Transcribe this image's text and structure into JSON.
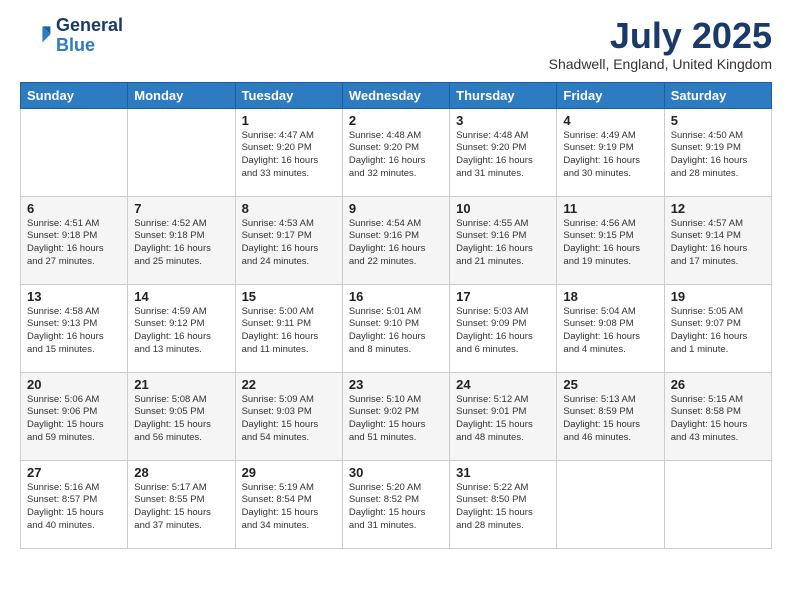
{
  "logo": {
    "general": "General",
    "blue": "Blue"
  },
  "title": "July 2025",
  "subtitle": "Shadwell, England, United Kingdom",
  "headers": [
    "Sunday",
    "Monday",
    "Tuesday",
    "Wednesday",
    "Thursday",
    "Friday",
    "Saturday"
  ],
  "weeks": [
    [
      null,
      null,
      {
        "num": "1",
        "sunrise": "4:47 AM",
        "sunset": "9:20 PM",
        "daylight": "16 hours and 33 minutes."
      },
      {
        "num": "2",
        "sunrise": "4:48 AM",
        "sunset": "9:20 PM",
        "daylight": "16 hours and 32 minutes."
      },
      {
        "num": "3",
        "sunrise": "4:48 AM",
        "sunset": "9:20 PM",
        "daylight": "16 hours and 31 minutes."
      },
      {
        "num": "4",
        "sunrise": "4:49 AM",
        "sunset": "9:19 PM",
        "daylight": "16 hours and 30 minutes."
      },
      {
        "num": "5",
        "sunrise": "4:50 AM",
        "sunset": "9:19 PM",
        "daylight": "16 hours and 28 minutes."
      }
    ],
    [
      {
        "num": "6",
        "sunrise": "4:51 AM",
        "sunset": "9:18 PM",
        "daylight": "16 hours and 27 minutes."
      },
      {
        "num": "7",
        "sunrise": "4:52 AM",
        "sunset": "9:18 PM",
        "daylight": "16 hours and 25 minutes."
      },
      {
        "num": "8",
        "sunrise": "4:53 AM",
        "sunset": "9:17 PM",
        "daylight": "16 hours and 24 minutes."
      },
      {
        "num": "9",
        "sunrise": "4:54 AM",
        "sunset": "9:16 PM",
        "daylight": "16 hours and 22 minutes."
      },
      {
        "num": "10",
        "sunrise": "4:55 AM",
        "sunset": "9:16 PM",
        "daylight": "16 hours and 21 minutes."
      },
      {
        "num": "11",
        "sunrise": "4:56 AM",
        "sunset": "9:15 PM",
        "daylight": "16 hours and 19 minutes."
      },
      {
        "num": "12",
        "sunrise": "4:57 AM",
        "sunset": "9:14 PM",
        "daylight": "16 hours and 17 minutes."
      }
    ],
    [
      {
        "num": "13",
        "sunrise": "4:58 AM",
        "sunset": "9:13 PM",
        "daylight": "16 hours and 15 minutes."
      },
      {
        "num": "14",
        "sunrise": "4:59 AM",
        "sunset": "9:12 PM",
        "daylight": "16 hours and 13 minutes."
      },
      {
        "num": "15",
        "sunrise": "5:00 AM",
        "sunset": "9:11 PM",
        "daylight": "16 hours and 11 minutes."
      },
      {
        "num": "16",
        "sunrise": "5:01 AM",
        "sunset": "9:10 PM",
        "daylight": "16 hours and 8 minutes."
      },
      {
        "num": "17",
        "sunrise": "5:03 AM",
        "sunset": "9:09 PM",
        "daylight": "16 hours and 6 minutes."
      },
      {
        "num": "18",
        "sunrise": "5:04 AM",
        "sunset": "9:08 PM",
        "daylight": "16 hours and 4 minutes."
      },
      {
        "num": "19",
        "sunrise": "5:05 AM",
        "sunset": "9:07 PM",
        "daylight": "16 hours and 1 minute."
      }
    ],
    [
      {
        "num": "20",
        "sunrise": "5:06 AM",
        "sunset": "9:06 PM",
        "daylight": "15 hours and 59 minutes."
      },
      {
        "num": "21",
        "sunrise": "5:08 AM",
        "sunset": "9:05 PM",
        "daylight": "15 hours and 56 minutes."
      },
      {
        "num": "22",
        "sunrise": "5:09 AM",
        "sunset": "9:03 PM",
        "daylight": "15 hours and 54 minutes."
      },
      {
        "num": "23",
        "sunrise": "5:10 AM",
        "sunset": "9:02 PM",
        "daylight": "15 hours and 51 minutes."
      },
      {
        "num": "24",
        "sunrise": "5:12 AM",
        "sunset": "9:01 PM",
        "daylight": "15 hours and 48 minutes."
      },
      {
        "num": "25",
        "sunrise": "5:13 AM",
        "sunset": "8:59 PM",
        "daylight": "15 hours and 46 minutes."
      },
      {
        "num": "26",
        "sunrise": "5:15 AM",
        "sunset": "8:58 PM",
        "daylight": "15 hours and 43 minutes."
      }
    ],
    [
      {
        "num": "27",
        "sunrise": "5:16 AM",
        "sunset": "8:57 PM",
        "daylight": "15 hours and 40 minutes."
      },
      {
        "num": "28",
        "sunrise": "5:17 AM",
        "sunset": "8:55 PM",
        "daylight": "15 hours and 37 minutes."
      },
      {
        "num": "29",
        "sunrise": "5:19 AM",
        "sunset": "8:54 PM",
        "daylight": "15 hours and 34 minutes."
      },
      {
        "num": "30",
        "sunrise": "5:20 AM",
        "sunset": "8:52 PM",
        "daylight": "15 hours and 31 minutes."
      },
      {
        "num": "31",
        "sunrise": "5:22 AM",
        "sunset": "8:50 PM",
        "daylight": "15 hours and 28 minutes."
      },
      null,
      null
    ]
  ],
  "labels": {
    "sunrise_prefix": "Sunrise: ",
    "sunset_prefix": "Sunset: ",
    "daylight_prefix": "Daylight: "
  }
}
